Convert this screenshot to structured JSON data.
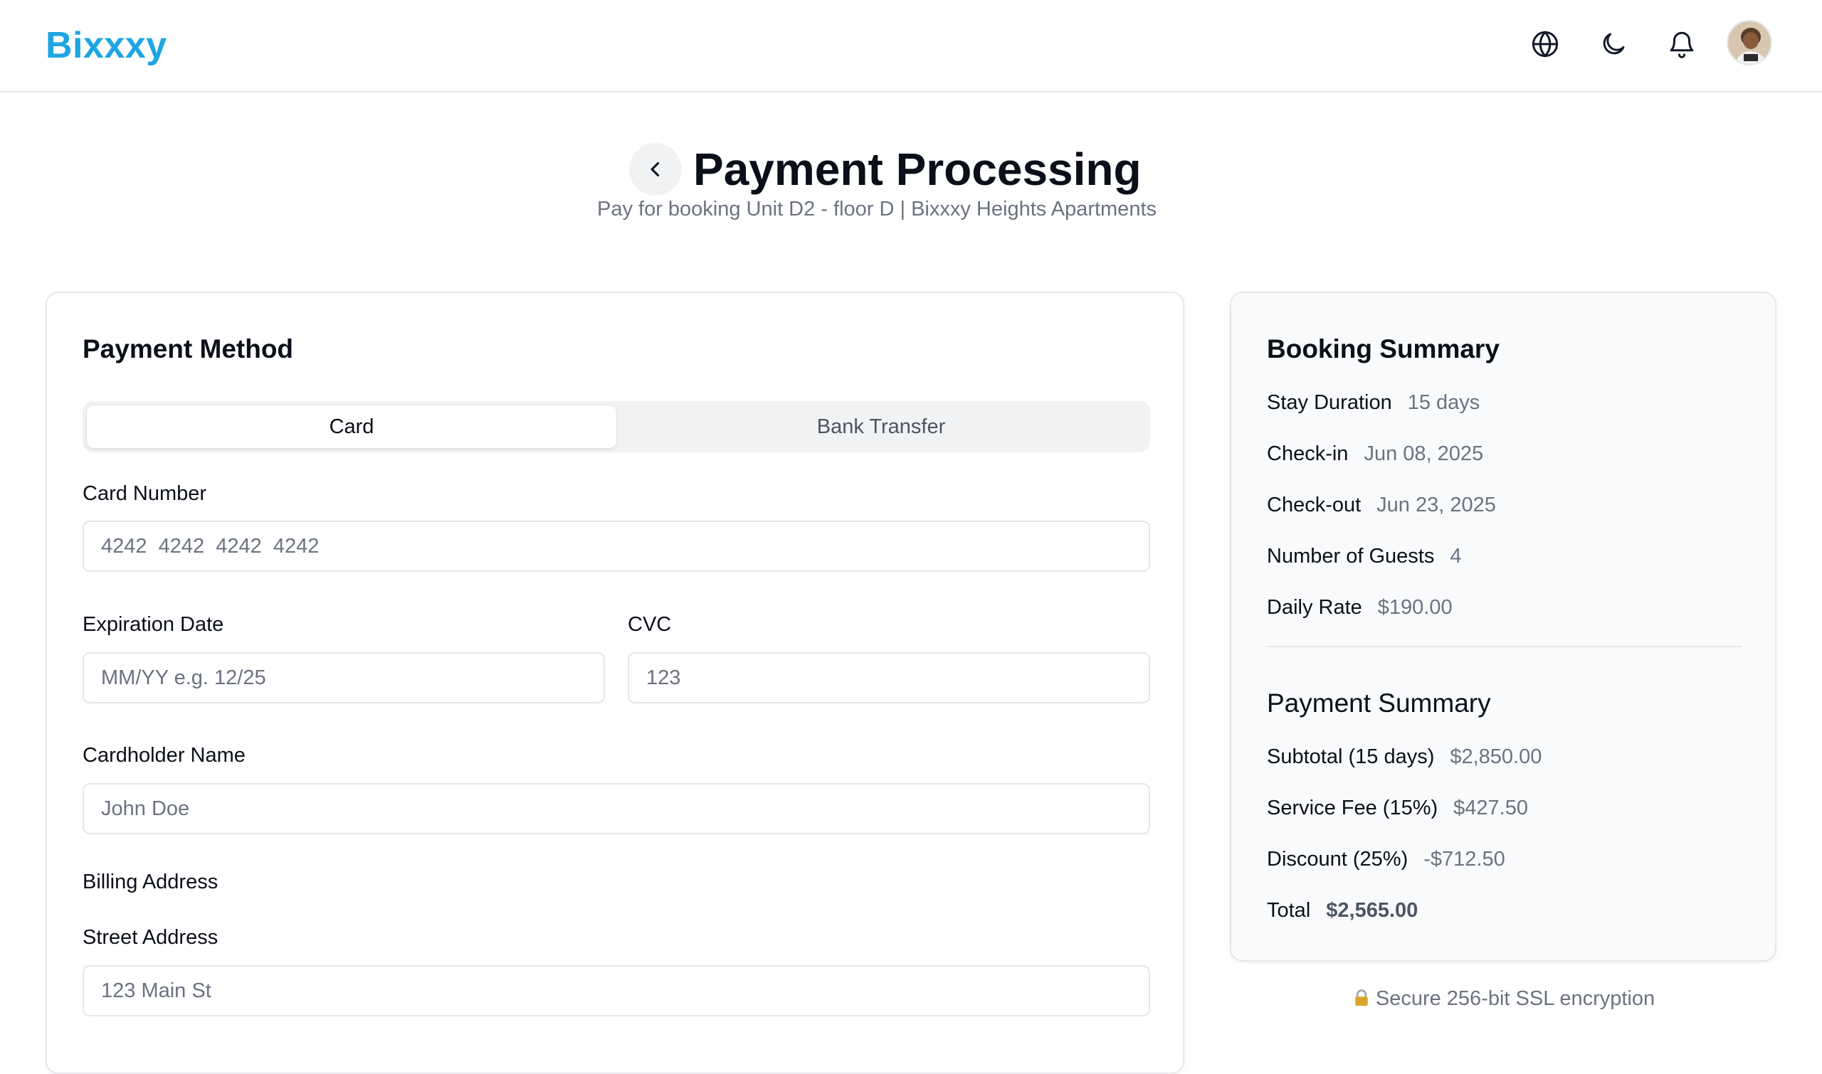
{
  "header": {
    "brand": "Bixxxy",
    "icons": {
      "language": "globe-icon",
      "theme": "moon-icon",
      "notifications": "bell-icon",
      "profile": "avatar"
    }
  },
  "page": {
    "title": "Payment Processing",
    "subtitle": "Pay for booking Unit D2 - floor D | Bixxxy Heights Apartments"
  },
  "payment_method": {
    "title": "Payment Method",
    "tabs": [
      {
        "label": "Card",
        "active": true
      },
      {
        "label": "Bank Transfer",
        "active": false
      }
    ],
    "fields": {
      "card_number": {
        "label": "Card Number",
        "placeholder": "4242  4242  4242  4242"
      },
      "expiration": {
        "label": "Expiration Date",
        "placeholder": "MM/YY e.g. 12/25"
      },
      "cvc": {
        "label": "CVC",
        "placeholder": "123"
      },
      "cardholder": {
        "label": "Cardholder Name",
        "placeholder": "John Doe"
      },
      "billing_heading": "Billing Address",
      "street": {
        "label": "Street Address",
        "placeholder": "123 Main St"
      }
    }
  },
  "booking_summary": {
    "title": "Booking Summary",
    "rows": [
      {
        "key": "Stay Duration",
        "value": "15 days"
      },
      {
        "key": "Check-in",
        "value": "Jun 08, 2025"
      },
      {
        "key": "Check-out",
        "value": "Jun 23, 2025"
      },
      {
        "key": "Number of Guests",
        "value": "4"
      },
      {
        "key": "Daily Rate",
        "value": "$190.00"
      }
    ]
  },
  "payment_summary": {
    "title": "Payment Summary",
    "rows": [
      {
        "key": "Subtotal (15 days)",
        "value": "$2,850.00"
      },
      {
        "key": "Service Fee (15%)",
        "value": "$427.50"
      },
      {
        "key": "Discount (25%)",
        "value": "-$712.50"
      },
      {
        "key": "Total",
        "value": "$2,565.00"
      }
    ]
  },
  "security": {
    "note": "Secure 256-bit SSL encryption",
    "icon": "lock-icon"
  },
  "colors": {
    "brand": "#1ea5e3",
    "text": "#0b0f19",
    "muted": "#6b7280",
    "border": "#e5e7eb",
    "summary_bg": "#f9fafb"
  }
}
